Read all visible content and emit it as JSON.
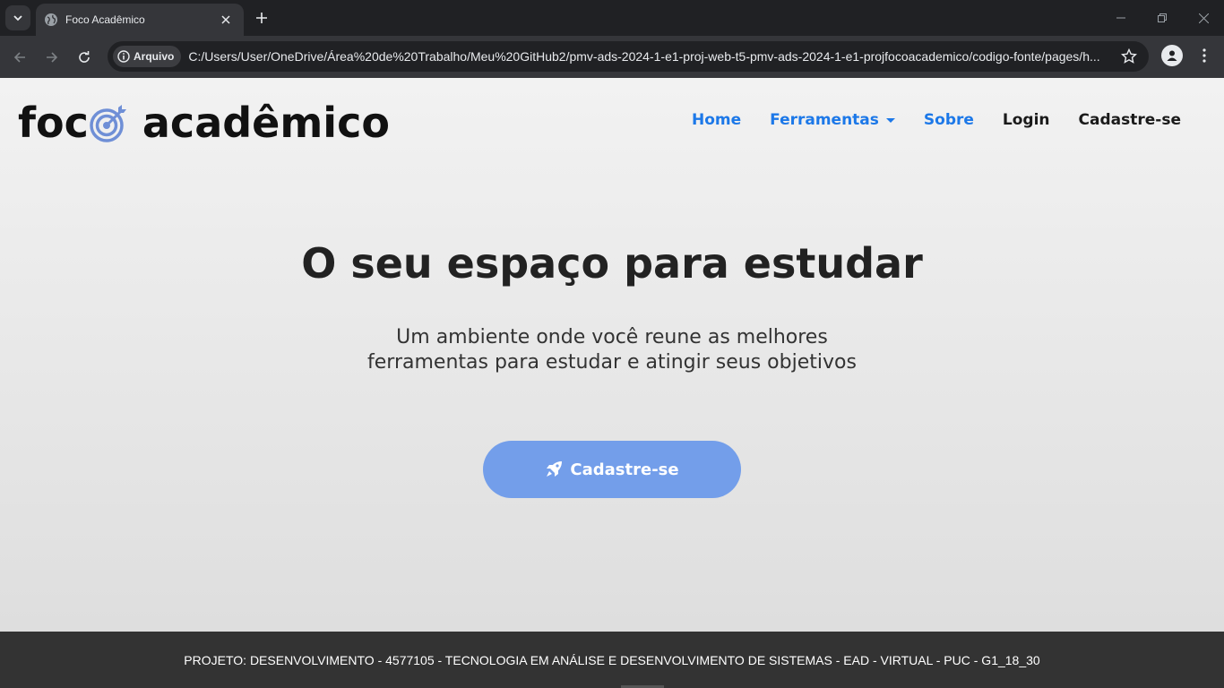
{
  "browser": {
    "tab_title": "Foco Acadêmico",
    "site_chip_label": "Arquivo",
    "url": "C:/Users/User/OneDrive/Área%20de%20Trabalho/Meu%20GitHub2/pmv-ads-2024-1-e1-proj-web-t5-pmv-ads-2024-1-e1-projfocoacademico/codigo-fonte/pages/h..."
  },
  "header": {
    "logo_part1": "foc",
    "logo_part2": "acadêmico",
    "nav": [
      {
        "label": "Home"
      },
      {
        "label": "Ferramentas"
      },
      {
        "label": "Sobre"
      },
      {
        "label": "Login"
      },
      {
        "label": "Cadastre-se"
      }
    ]
  },
  "hero": {
    "title": "O seu espaço para estudar",
    "subtitle_line1": "Um ambiente onde você reune as melhores",
    "subtitle_line2": "ferramentas para estudar e atingir seus objetivos",
    "cta_label": "Cadastre-se"
  },
  "footer": {
    "text": "PROJETO: DESENVOLVIMENTO - 4577105 - TECNOLOGIA EM ANÁLISE E DESENVOLVIMENTO DE SISTEMAS - EAD - VIRTUAL - PUC - G1_18_30"
  },
  "colors": {
    "accent_blue": "#1c78e8",
    "cta_blue": "#739eea",
    "footer_bg": "#333333"
  }
}
